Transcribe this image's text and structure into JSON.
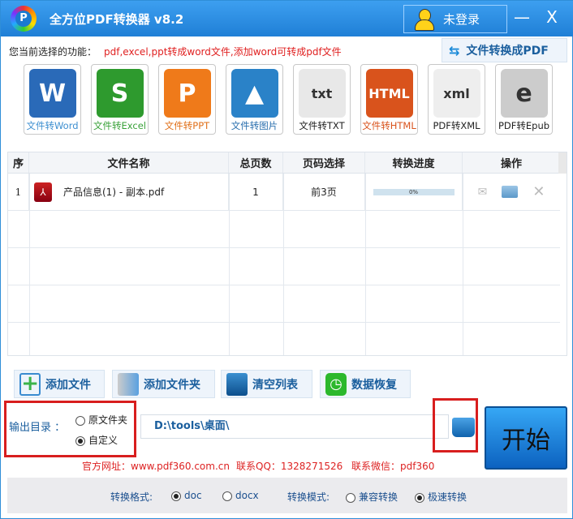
{
  "window": {
    "title": "全方位PDF转换器 v8.2",
    "login": "未登录",
    "minimize": "—",
    "close": "X"
  },
  "function": {
    "label": "您当前选择的功能：",
    "value": "pdf,excel,ppt转成word文件,添加word可转成pdf文件",
    "to_pdf_button": "文件转换成PDF"
  },
  "tools": [
    {
      "label": "文件转Word",
      "icon": "W",
      "color": "#2a6ab8",
      "text_color": "#3d8fd0"
    },
    {
      "label": "文件转Excel",
      "icon": "S",
      "color": "#2e9a2e",
      "text_color": "#3aa23a"
    },
    {
      "label": "文件转PPT",
      "icon": "P",
      "color": "#ef7a1a",
      "text_color": "#e0701a"
    },
    {
      "label": "文件转图片",
      "icon": "▲",
      "color": "#2a82c8",
      "text_color": "#2a6fae"
    },
    {
      "label": "文件转TXT",
      "icon": "txt",
      "color": "#e8e8e8",
      "text_color": "#222"
    },
    {
      "label": "文件转HTML",
      "icon": "HTML",
      "color": "#d9531c",
      "text_color": "#d9531c"
    },
    {
      "label": "PDF转XML",
      "icon": "xml",
      "color": "#eeeeee",
      "text_color": "#222"
    },
    {
      "label": "PDF转Epub",
      "icon": "e",
      "color": "#cccccc",
      "text_color": "#222"
    }
  ],
  "table": {
    "headers": [
      "序",
      "文件名称",
      "总页数",
      "页码选择",
      "转换进度",
      "操作"
    ],
    "rows": [
      {
        "index": "1",
        "name": "产品信息(1) - 副本.pdf",
        "pages": "1",
        "range": "前3页",
        "progress": "0%",
        "progress_value": 0
      }
    ]
  },
  "actions": {
    "add_file": "添加文件",
    "add_folder": "添加文件夹",
    "clear": "清空列表",
    "restore": "数据恢复"
  },
  "output": {
    "label": "输出目录 ：",
    "option_original": "原文件夹",
    "option_custom": "自定义",
    "selected": "custom",
    "path": "D:\\tools\\桌面\\",
    "start": "开始"
  },
  "contact": {
    "site": "官方网址：www.pdf360.com.cn",
    "qq": "联系QQ：1328271526",
    "wechat": "联系微信：pdf360"
  },
  "settings": {
    "format_label": "转换格式:",
    "format_doc": "doc",
    "format_docx": "docx",
    "format_selected": "doc",
    "mode_label": "转换模式:",
    "mode_compat": "兼容转换",
    "mode_fast": "极速转换",
    "mode_selected": "fast"
  }
}
